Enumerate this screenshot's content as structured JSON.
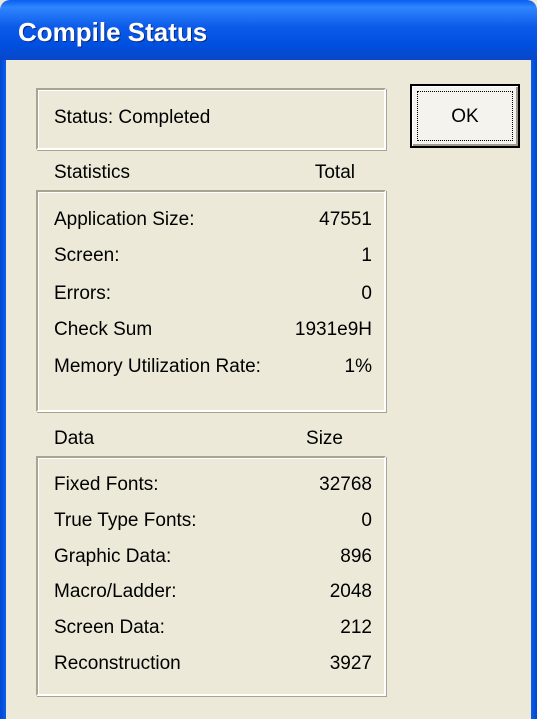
{
  "window": {
    "title": "Compile Status"
  },
  "status": {
    "text": "Status:  Completed"
  },
  "ok_button": {
    "label": "OK"
  },
  "statistics": {
    "header": "Statistics",
    "value_header": "Total",
    "rows": [
      {
        "label": "Application Size:",
        "value": "47551"
      },
      {
        "label": "Screen:",
        "value": "1"
      },
      {
        "label": "Errors:",
        "value": "0"
      },
      {
        "label": "Check Sum",
        "value": "1931e9H"
      },
      {
        "label": "Memory Utilization Rate:",
        "value": "1%"
      }
    ]
  },
  "data": {
    "header": "Data",
    "value_header": "Size",
    "rows": [
      {
        "label": "Fixed Fonts:",
        "value": "32768"
      },
      {
        "label": "True Type Fonts:",
        "value": "0"
      },
      {
        "label": "Graphic Data:",
        "value": "896"
      },
      {
        "label": "Macro/Ladder:",
        "value": "2048"
      },
      {
        "label": "Screen Data:",
        "value": "212"
      },
      {
        "label": "Reconstruction",
        "value": "3927"
      }
    ]
  }
}
